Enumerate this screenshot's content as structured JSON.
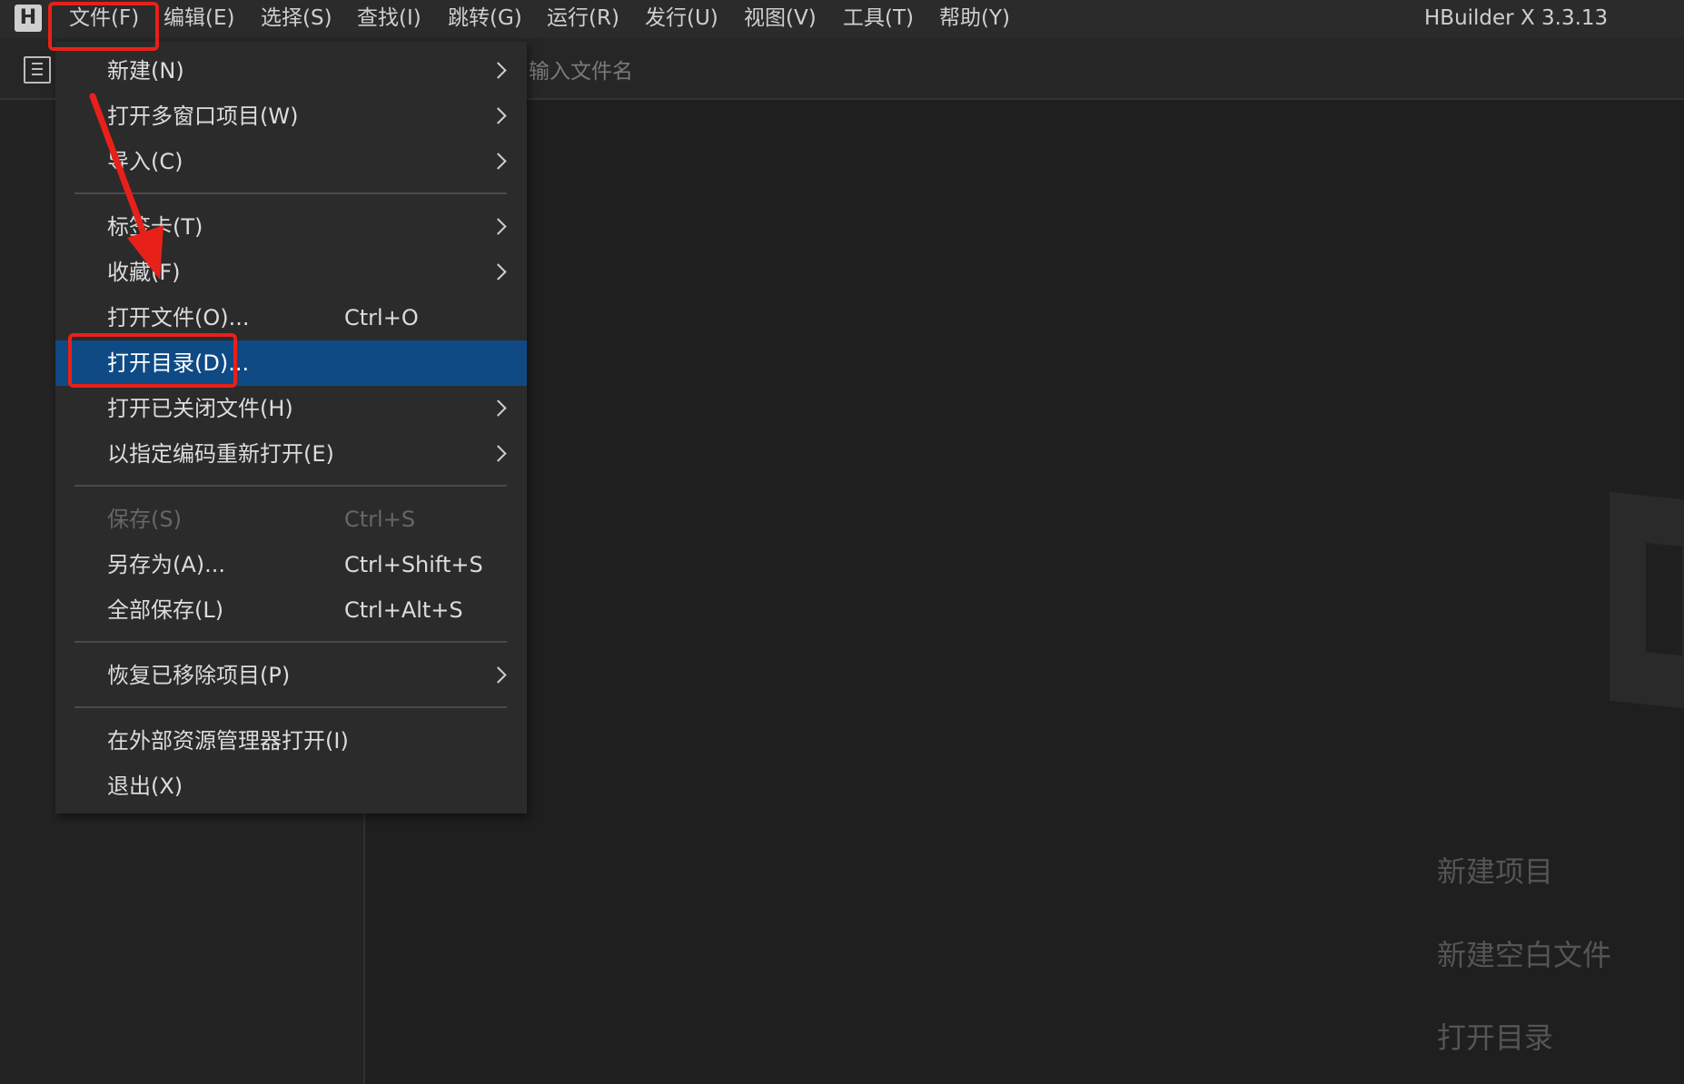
{
  "menubar": {
    "items": [
      {
        "label": "文件(F)"
      },
      {
        "label": "编辑(E)"
      },
      {
        "label": "选择(S)"
      },
      {
        "label": "查找(I)"
      },
      {
        "label": "跳转(G)"
      },
      {
        "label": "运行(R)"
      },
      {
        "label": "发行(U)"
      },
      {
        "label": "视图(V)"
      },
      {
        "label": "工具(T)"
      },
      {
        "label": "帮助(Y)"
      }
    ],
    "app_title": "HBuilder X 3.3.13",
    "logo_letter": "H"
  },
  "toolbar": {
    "search_placeholder": "输入文件名"
  },
  "file_menu": {
    "items": [
      {
        "label": "新建(N)",
        "shortcut": "",
        "submenu": true
      },
      {
        "label": "打开多窗口项目(W)",
        "shortcut": "",
        "submenu": true
      },
      {
        "label": "导入(C)",
        "shortcut": "",
        "submenu": true
      },
      {
        "label": "标签卡(T)",
        "shortcut": "",
        "submenu": true
      },
      {
        "label": "收藏(F)",
        "shortcut": "",
        "submenu": true
      },
      {
        "label": "打开文件(O)...",
        "shortcut": "Ctrl+O",
        "submenu": false
      },
      {
        "label": "打开目录(D)...",
        "shortcut": "",
        "submenu": false,
        "highlighted": true
      },
      {
        "label": "打开已关闭文件(H)",
        "shortcut": "",
        "submenu": true
      },
      {
        "label": "以指定编码重新打开(E)",
        "shortcut": "",
        "submenu": true
      },
      {
        "label": "保存(S)",
        "shortcut": "Ctrl+S",
        "submenu": false,
        "disabled": true
      },
      {
        "label": "另存为(A)...",
        "shortcut": "Ctrl+Shift+S",
        "submenu": false
      },
      {
        "label": "全部保存(L)",
        "shortcut": "Ctrl+Alt+S",
        "submenu": false
      },
      {
        "label": "恢复已移除项目(P)",
        "shortcut": "",
        "submenu": true
      },
      {
        "label": "在外部资源管理器打开(I)",
        "shortcut": "",
        "submenu": false
      },
      {
        "label": "退出(X)",
        "shortcut": "",
        "submenu": false
      }
    ]
  },
  "welcome": {
    "links": [
      {
        "label": "新建项目"
      },
      {
        "label": "新建空白文件"
      },
      {
        "label": "打开目录"
      }
    ]
  },
  "colors": {
    "highlight": "#0f4a85",
    "annotation": "#e8201a"
  }
}
